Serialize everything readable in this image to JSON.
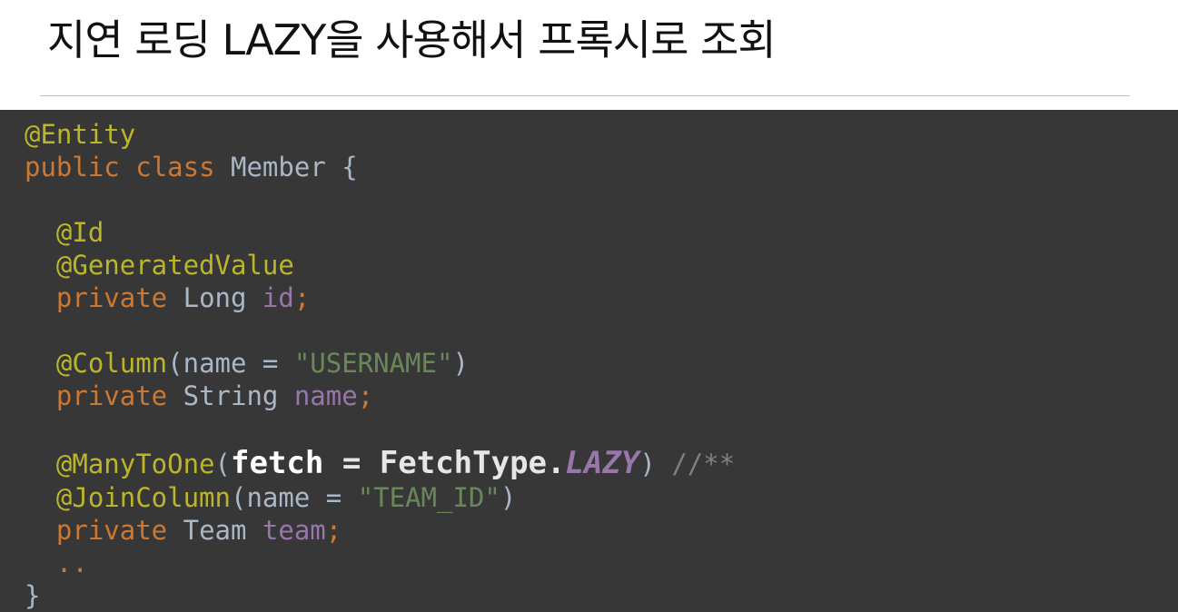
{
  "slide": {
    "title": "지연 로딩 LAZY을 사용해서 프록시로 조회"
  },
  "code": {
    "l1_annotation": "@Entity",
    "l2_public": "public",
    "l2_class": "class",
    "l2_name": "Member",
    "l2_brace": "{",
    "l4_annotation": "@Id",
    "l5_annotation": "@GeneratedValue",
    "l6_private": "private",
    "l6_type": "Long",
    "l6_field": "id",
    "l6_semi": ";",
    "l8_annotation": "@Column",
    "l8_open": "(",
    "l8_param": "name",
    "l8_eq": " = ",
    "l8_string": "\"USERNAME\"",
    "l8_close": ")",
    "l9_private": "private",
    "l9_type": "String",
    "l9_field": "name",
    "l9_semi": ";",
    "l11_annotation": "@ManyToOne",
    "l11_open": "(",
    "l11_param": "fetch",
    "l11_eq": " = ",
    "l11_type": "FetchType.",
    "l11_lazy": "LAZY",
    "l11_close": ")",
    "l11_comment": "//**",
    "l12_annotation": "@JoinColumn",
    "l12_open": "(",
    "l12_param": "name",
    "l12_eq": " = ",
    "l12_string": "\"TEAM_ID\"",
    "l12_close": ")",
    "l13_private": "private",
    "l13_type": "Team",
    "l13_field": "team",
    "l13_semi": ";",
    "l14_ellipsis": "..",
    "l15_brace": "}"
  },
  "colors": {
    "code_background": "#373737",
    "annotation": "#bbb529",
    "keyword": "#cc7832",
    "field": "#9876aa",
    "string": "#6a8759",
    "comment": "#808080"
  }
}
